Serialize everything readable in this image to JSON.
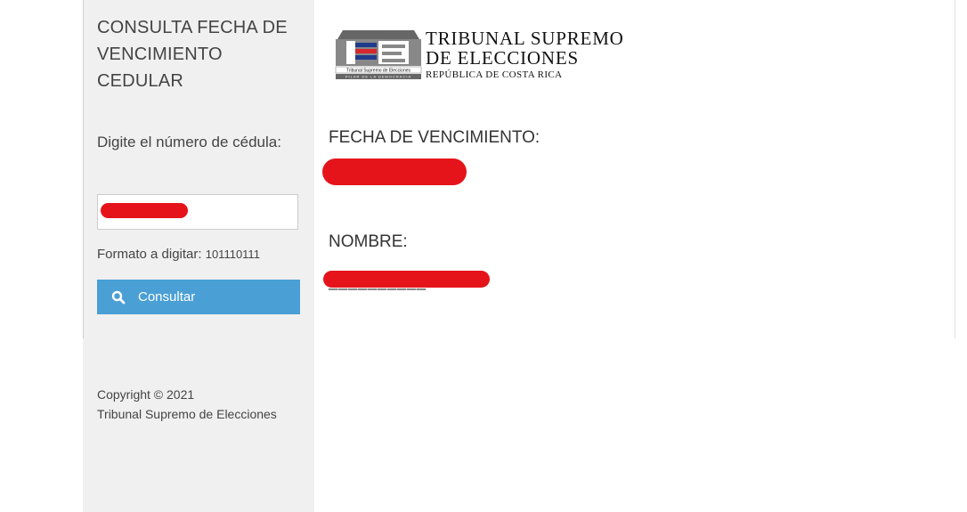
{
  "sidebar": {
    "title": "CONSULTA FECHA DE VENCIMIENTO CEDULAR",
    "prompt": "Digite el número de cédula:",
    "input_value": "",
    "format_label": "Formato a digitar:",
    "format_example": "101110111",
    "button_label": "Consultar",
    "copyright_line1": "Copyright © 2021",
    "copyright_line2": "Tribunal Supremo de Elecciones"
  },
  "logo": {
    "line1": "TRIBUNAL SUPREMO",
    "line2": "DE ELECCIONES",
    "line3": "REPÚBLICA DE COSTA RICA",
    "emblem_text": "Tribunal Supremo de Elecciones",
    "emblem_sub": "PILAR DE LA DEMOCRACIA"
  },
  "result": {
    "fecha_label": "FECHA DE VENCIMIENTO:",
    "fecha_value": "",
    "nombre_label": "NOMBRE:",
    "nombre_value": "__________"
  },
  "colors": {
    "button": "#4a9fd5",
    "sidebar_bg": "#f0f0f0",
    "redaction": "#e5141b"
  }
}
